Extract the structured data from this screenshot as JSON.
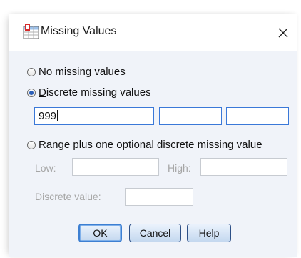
{
  "dialog": {
    "title": "Missing Values",
    "icon": "spss-variable-icon",
    "close_icon": "close-icon"
  },
  "options": {
    "no_missing": {
      "prefix": "",
      "mnemonic": "N",
      "rest": "o missing values",
      "checked": false
    },
    "discrete": {
      "prefix": "",
      "mnemonic": "D",
      "rest": "iscrete missing values",
      "checked": true
    },
    "range": {
      "prefix": "",
      "mnemonic": "R",
      "rest": "ange plus one optional discrete missing value",
      "checked": false
    }
  },
  "discrete_values": [
    "999",
    "",
    ""
  ],
  "range": {
    "low_label": "Low:",
    "high_label": "High:",
    "discrete_label": "Discrete value:",
    "low_value": "",
    "high_value": "",
    "discrete_value": ""
  },
  "buttons": {
    "ok": "OK",
    "cancel": "Cancel",
    "help": "Help"
  }
}
